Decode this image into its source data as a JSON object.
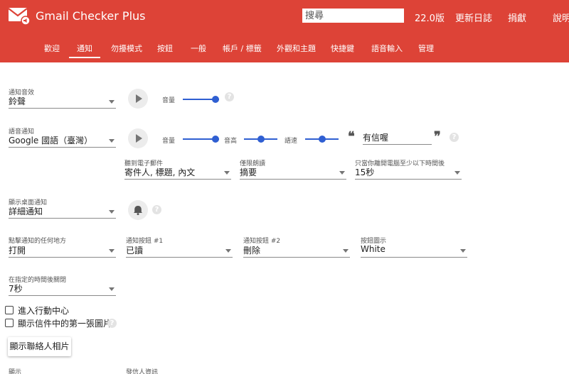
{
  "header": {
    "app_title": "Gmail Checker Plus",
    "search_placeholder": "搜尋",
    "version": "22.0版",
    "changelog": "更新日誌",
    "donate": "捐獻",
    "help": "說明",
    "bg_color": "#DD4337"
  },
  "tabs": [
    "歡迎",
    "通知",
    "勿擾模式",
    "按鈕",
    "一般",
    "帳戶 / 標籤",
    "外觀和主題",
    "快捷鍵",
    "語音輸入",
    "管理"
  ],
  "active_tab": "通知",
  "form": {
    "sound": {
      "label": "通知音效",
      "value": "鈴聲",
      "volume_label": "音量",
      "volume": 1.0
    },
    "voice": {
      "label": "語音通知",
      "value": "Google 國語（臺灣）",
      "volume_label": "音量",
      "volume": 1.0,
      "pitch_label": "音高",
      "pitch": 0.5,
      "rate_label": "語速",
      "rate": 0.5,
      "phrase": "有信喔",
      "open_quote": "❝",
      "close_quote": "❞"
    },
    "read_email": {
      "label": "聽到電子郵件",
      "value": "寄件人, 標題, 內文"
    },
    "read_only": {
      "label": "僅限朗讀",
      "value": "摘要"
    },
    "idle": {
      "label": "只當你離開電腦至少以下時間後",
      "value": "15秒"
    },
    "desktop": {
      "label": "顯示桌面通知",
      "value": "詳細通知"
    },
    "click_anywhere": {
      "label": "點擊通知的任何地方",
      "value": "打開"
    },
    "button1": {
      "label": "通知按鈕 #1",
      "value": "已讀"
    },
    "button2": {
      "label": "通知按鈕 #2",
      "value": "刪除"
    },
    "button_display": {
      "label": "按鈕圖示",
      "value": "White"
    },
    "auto_close": {
      "label": "在指定的時間後關閉",
      "value": "7秒"
    },
    "checkbox_action_center": "進入行動中心",
    "checkbox_first_image": "顯示信件中的第一張圖片",
    "contact_photos_button": "顯示聯絡人相片",
    "bottom_label_1": "顯示",
    "bottom_label_2": "發信人資訊"
  },
  "help_glyph": "?",
  "accent_color": "#2F5FD2"
}
